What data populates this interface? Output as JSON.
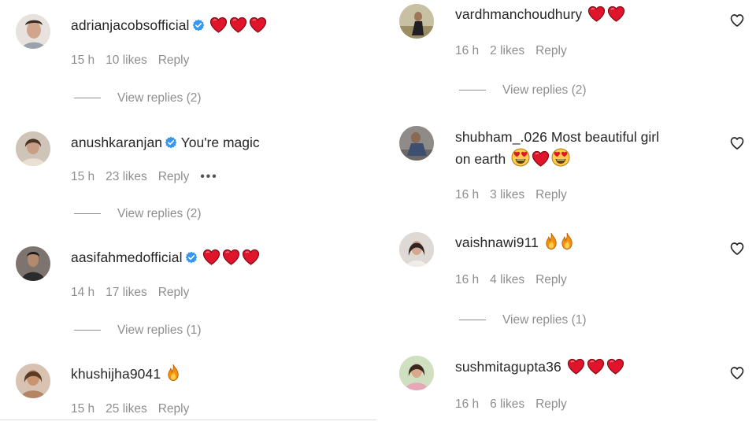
{
  "left_comments": [
    {
      "username": "adrianjacobsofficial",
      "verified": true,
      "text": "",
      "emojis": [
        "red-heart",
        "red-heart",
        "red-heart"
      ],
      "time": "15 h",
      "likes": "10 likes",
      "reply_label": "Reply",
      "view_replies": "View replies (2)"
    },
    {
      "username": "anushkaranjan",
      "verified": true,
      "text": "You're magic",
      "emojis": [],
      "time": "15 h",
      "likes": "23 likes",
      "reply_label": "Reply",
      "more_label": "•••",
      "view_replies": "View replies (2)"
    },
    {
      "username": "aasifahmedofficial",
      "verified": true,
      "text": "",
      "emojis": [
        "red-heart",
        "red-heart",
        "red-heart"
      ],
      "time": "14 h",
      "likes": "17 likes",
      "reply_label": "Reply",
      "view_replies": "View replies (1)"
    },
    {
      "username": "khushijha9041",
      "verified": false,
      "text": "",
      "emojis": [
        "fire"
      ],
      "time": "15 h",
      "likes": "25 likes",
      "reply_label": "Reply"
    }
  ],
  "right_comments": [
    {
      "username": "vardhmanchoudhury",
      "text": "",
      "emojis": [
        "red-heart",
        "red-heart"
      ],
      "time": "16 h",
      "likes": "2 likes",
      "reply_label": "Reply",
      "view_replies": "View replies (2)"
    },
    {
      "username": "shubham_.026",
      "text_line1": "Most beautiful girl",
      "text_line2": "on earth",
      "emojis": [
        "heart-eyes",
        "red-heart",
        "heart-eyes"
      ],
      "time": "16 h",
      "likes": "3 likes",
      "reply_label": "Reply"
    },
    {
      "username": "vaishnawi911",
      "text": "",
      "emojis": [
        "fire",
        "fire"
      ],
      "time": "16 h",
      "likes": "4 likes",
      "reply_label": "Reply",
      "view_replies": "View replies (1)"
    },
    {
      "username": "sushmitagupta36",
      "text": "",
      "emojis": [
        "red-heart",
        "red-heart",
        "red-heart"
      ],
      "time": "16 h",
      "likes": "6 likes",
      "reply_label": "Reply"
    }
  ],
  "icons": {
    "verified": "verified-badge-icon",
    "like": "heart-outline-icon",
    "heart_emoji": "red-heart-emoji-icon",
    "fire_emoji": "fire-emoji-icon",
    "heart_eyes_emoji": "heart-eyes-emoji-icon"
  },
  "colors": {
    "text": "#262626",
    "secondary_text": "#8e8e8e",
    "verified_blue": "#3897f0",
    "heart_red": "#e0142b"
  }
}
